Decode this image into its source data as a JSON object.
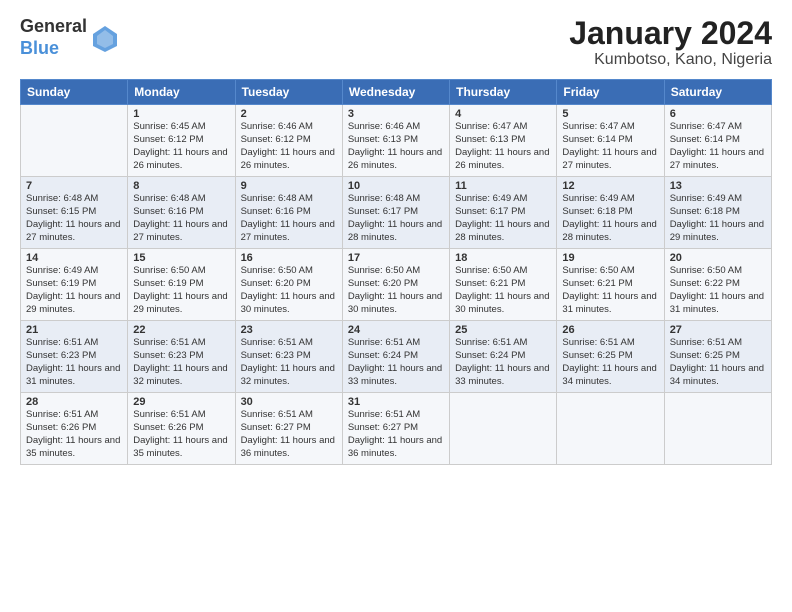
{
  "logo": {
    "general": "General",
    "blue": "Blue"
  },
  "title": "January 2024",
  "subtitle": "Kumbotso, Kano, Nigeria",
  "headers": [
    "Sunday",
    "Monday",
    "Tuesday",
    "Wednesday",
    "Thursday",
    "Friday",
    "Saturday"
  ],
  "weeks": [
    [
      {
        "day": "",
        "sunrise": "",
        "sunset": "",
        "daylight": ""
      },
      {
        "day": "1",
        "sunrise": "Sunrise: 6:45 AM",
        "sunset": "Sunset: 6:12 PM",
        "daylight": "Daylight: 11 hours and 26 minutes."
      },
      {
        "day": "2",
        "sunrise": "Sunrise: 6:46 AM",
        "sunset": "Sunset: 6:12 PM",
        "daylight": "Daylight: 11 hours and 26 minutes."
      },
      {
        "day": "3",
        "sunrise": "Sunrise: 6:46 AM",
        "sunset": "Sunset: 6:13 PM",
        "daylight": "Daylight: 11 hours and 26 minutes."
      },
      {
        "day": "4",
        "sunrise": "Sunrise: 6:47 AM",
        "sunset": "Sunset: 6:13 PM",
        "daylight": "Daylight: 11 hours and 26 minutes."
      },
      {
        "day": "5",
        "sunrise": "Sunrise: 6:47 AM",
        "sunset": "Sunset: 6:14 PM",
        "daylight": "Daylight: 11 hours and 27 minutes."
      },
      {
        "day": "6",
        "sunrise": "Sunrise: 6:47 AM",
        "sunset": "Sunset: 6:14 PM",
        "daylight": "Daylight: 11 hours and 27 minutes."
      }
    ],
    [
      {
        "day": "7",
        "sunrise": "Sunrise: 6:48 AM",
        "sunset": "Sunset: 6:15 PM",
        "daylight": "Daylight: 11 hours and 27 minutes."
      },
      {
        "day": "8",
        "sunrise": "Sunrise: 6:48 AM",
        "sunset": "Sunset: 6:16 PM",
        "daylight": "Daylight: 11 hours and 27 minutes."
      },
      {
        "day": "9",
        "sunrise": "Sunrise: 6:48 AM",
        "sunset": "Sunset: 6:16 PM",
        "daylight": "Daylight: 11 hours and 27 minutes."
      },
      {
        "day": "10",
        "sunrise": "Sunrise: 6:48 AM",
        "sunset": "Sunset: 6:17 PM",
        "daylight": "Daylight: 11 hours and 28 minutes."
      },
      {
        "day": "11",
        "sunrise": "Sunrise: 6:49 AM",
        "sunset": "Sunset: 6:17 PM",
        "daylight": "Daylight: 11 hours and 28 minutes."
      },
      {
        "day": "12",
        "sunrise": "Sunrise: 6:49 AM",
        "sunset": "Sunset: 6:18 PM",
        "daylight": "Daylight: 11 hours and 28 minutes."
      },
      {
        "day": "13",
        "sunrise": "Sunrise: 6:49 AM",
        "sunset": "Sunset: 6:18 PM",
        "daylight": "Daylight: 11 hours and 29 minutes."
      }
    ],
    [
      {
        "day": "14",
        "sunrise": "Sunrise: 6:49 AM",
        "sunset": "Sunset: 6:19 PM",
        "daylight": "Daylight: 11 hours and 29 minutes."
      },
      {
        "day": "15",
        "sunrise": "Sunrise: 6:50 AM",
        "sunset": "Sunset: 6:19 PM",
        "daylight": "Daylight: 11 hours and 29 minutes."
      },
      {
        "day": "16",
        "sunrise": "Sunrise: 6:50 AM",
        "sunset": "Sunset: 6:20 PM",
        "daylight": "Daylight: 11 hours and 30 minutes."
      },
      {
        "day": "17",
        "sunrise": "Sunrise: 6:50 AM",
        "sunset": "Sunset: 6:20 PM",
        "daylight": "Daylight: 11 hours and 30 minutes."
      },
      {
        "day": "18",
        "sunrise": "Sunrise: 6:50 AM",
        "sunset": "Sunset: 6:21 PM",
        "daylight": "Daylight: 11 hours and 30 minutes."
      },
      {
        "day": "19",
        "sunrise": "Sunrise: 6:50 AM",
        "sunset": "Sunset: 6:21 PM",
        "daylight": "Daylight: 11 hours and 31 minutes."
      },
      {
        "day": "20",
        "sunrise": "Sunrise: 6:50 AM",
        "sunset": "Sunset: 6:22 PM",
        "daylight": "Daylight: 11 hours and 31 minutes."
      }
    ],
    [
      {
        "day": "21",
        "sunrise": "Sunrise: 6:51 AM",
        "sunset": "Sunset: 6:23 PM",
        "daylight": "Daylight: 11 hours and 31 minutes."
      },
      {
        "day": "22",
        "sunrise": "Sunrise: 6:51 AM",
        "sunset": "Sunset: 6:23 PM",
        "daylight": "Daylight: 11 hours and 32 minutes."
      },
      {
        "day": "23",
        "sunrise": "Sunrise: 6:51 AM",
        "sunset": "Sunset: 6:23 PM",
        "daylight": "Daylight: 11 hours and 32 minutes."
      },
      {
        "day": "24",
        "sunrise": "Sunrise: 6:51 AM",
        "sunset": "Sunset: 6:24 PM",
        "daylight": "Daylight: 11 hours and 33 minutes."
      },
      {
        "day": "25",
        "sunrise": "Sunrise: 6:51 AM",
        "sunset": "Sunset: 6:24 PM",
        "daylight": "Daylight: 11 hours and 33 minutes."
      },
      {
        "day": "26",
        "sunrise": "Sunrise: 6:51 AM",
        "sunset": "Sunset: 6:25 PM",
        "daylight": "Daylight: 11 hours and 34 minutes."
      },
      {
        "day": "27",
        "sunrise": "Sunrise: 6:51 AM",
        "sunset": "Sunset: 6:25 PM",
        "daylight": "Daylight: 11 hours and 34 minutes."
      }
    ],
    [
      {
        "day": "28",
        "sunrise": "Sunrise: 6:51 AM",
        "sunset": "Sunset: 6:26 PM",
        "daylight": "Daylight: 11 hours and 35 minutes."
      },
      {
        "day": "29",
        "sunrise": "Sunrise: 6:51 AM",
        "sunset": "Sunset: 6:26 PM",
        "daylight": "Daylight: 11 hours and 35 minutes."
      },
      {
        "day": "30",
        "sunrise": "Sunrise: 6:51 AM",
        "sunset": "Sunset: 6:27 PM",
        "daylight": "Daylight: 11 hours and 36 minutes."
      },
      {
        "day": "31",
        "sunrise": "Sunrise: 6:51 AM",
        "sunset": "Sunset: 6:27 PM",
        "daylight": "Daylight: 11 hours and 36 minutes."
      },
      {
        "day": "",
        "sunrise": "",
        "sunset": "",
        "daylight": ""
      },
      {
        "day": "",
        "sunrise": "",
        "sunset": "",
        "daylight": ""
      },
      {
        "day": "",
        "sunrise": "",
        "sunset": "",
        "daylight": ""
      }
    ]
  ]
}
